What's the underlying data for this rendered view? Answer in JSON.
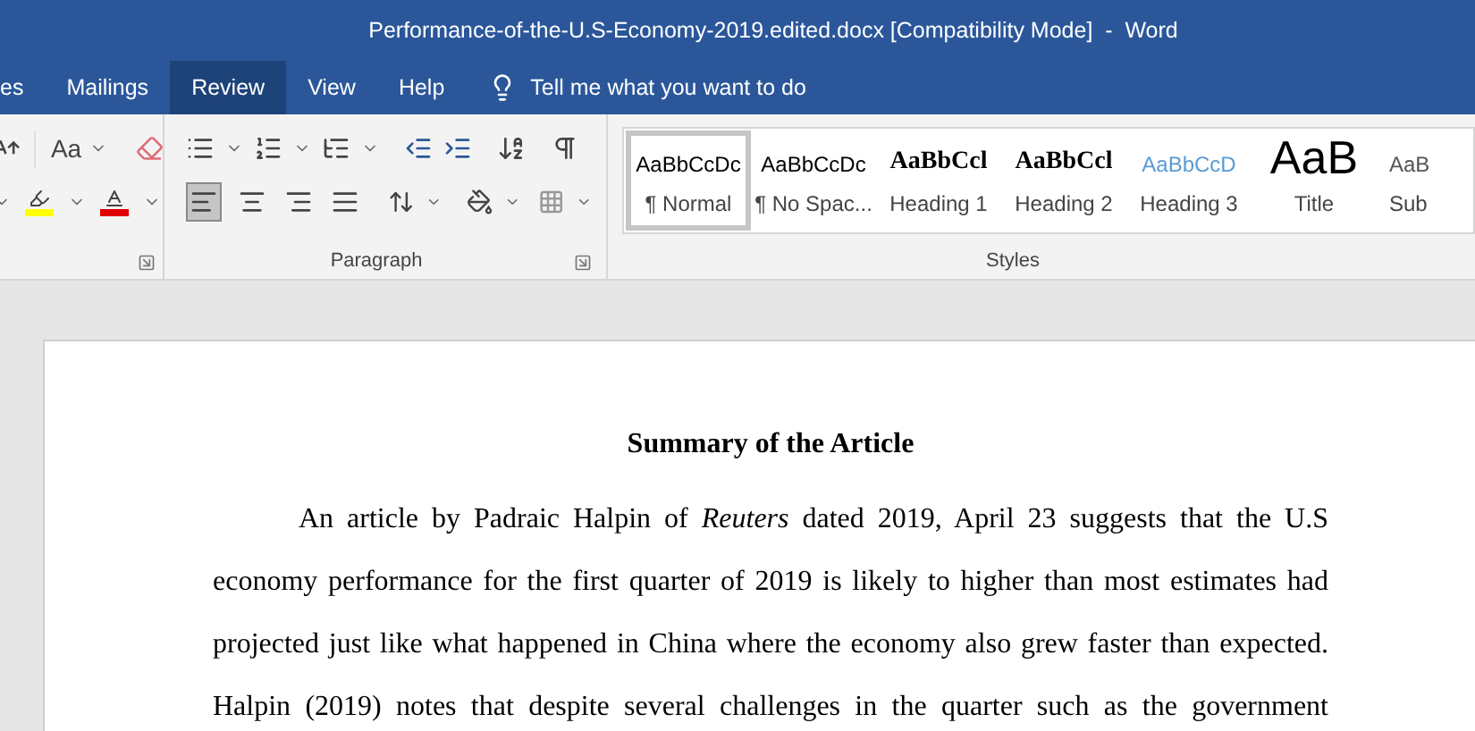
{
  "window": {
    "title": "Performance-of-the-U.S-Economy-2019.edited.docx [Compatibility Mode]  -  Word"
  },
  "tabs": [
    {
      "label": "es",
      "selected": false
    },
    {
      "label": "Mailings",
      "selected": false
    },
    {
      "label": "Review",
      "selected": true
    },
    {
      "label": "View",
      "selected": false
    },
    {
      "label": "Help",
      "selected": false
    }
  ],
  "tell_me": {
    "placeholder": "Tell me what you want to do"
  },
  "font_group": {
    "change_case": "Aa"
  },
  "paragraph_group": {
    "label": "Paragraph",
    "alignment": [
      {
        "kind": "left",
        "selected": true
      },
      {
        "kind": "center",
        "selected": false
      },
      {
        "kind": "right",
        "selected": false
      },
      {
        "kind": "justify",
        "selected": false
      }
    ]
  },
  "styles_group": {
    "label": "Styles",
    "styles": [
      {
        "kind": "normal",
        "preview": "AaBbCcDc",
        "name": "¶ Normal",
        "selected": true
      },
      {
        "kind": "normal",
        "preview": "AaBbCcDc",
        "name": "¶ No Spac...",
        "selected": false
      },
      {
        "kind": "heading1",
        "preview": "AaBbCcl",
        "name": "Heading 1",
        "selected": false
      },
      {
        "kind": "heading2",
        "preview": "AaBbCcl",
        "name": "Heading 2",
        "selected": false
      },
      {
        "kind": "heading3",
        "preview": "AaBbCcD",
        "name": "Heading 3",
        "selected": false
      },
      {
        "kind": "title",
        "preview": "AaB",
        "name": "Title",
        "selected": false
      },
      {
        "kind": "subtitle",
        "preview": "AaB",
        "name": "Sub",
        "selected": false
      }
    ]
  },
  "document": {
    "heading": "Summary of the Article",
    "paragraph": {
      "lines": [
        "An article by Padraic Halpin of *Reuters* dated 2019, April 23 suggests that the U.S",
        "economy performance for the first quarter of 2019 is likely to higher than most estimates had",
        "projected just like what happened in China where the economy also grew faster than expected.",
        "Halpin (2019) notes that despite several challenges in the quarter such as the government"
      ]
    }
  }
}
